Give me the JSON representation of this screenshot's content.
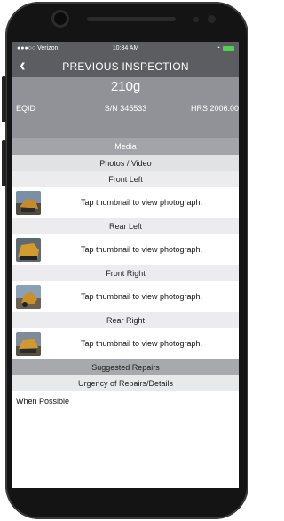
{
  "status": {
    "carrier": "●●●○○ Verizon",
    "time": "10:34 AM"
  },
  "nav": {
    "back_icon": "chevron-left-icon",
    "title": "PREVIOUS INSPECTION"
  },
  "equipment": {
    "model": "210g",
    "eqid_label": "EQID",
    "serial": "S/N 345533",
    "hours": "HRS 2006.00"
  },
  "media": {
    "header": "Media",
    "photos_header": "Photos / Video",
    "photos": [
      {
        "label": "Front Left",
        "tap_text": "Tap thumbnail to view photograph."
      },
      {
        "label": "Rear Left",
        "tap_text": "Tap thumbnail to view photograph."
      },
      {
        "label": "Front Right",
        "tap_text": "Tap thumbnail to view photograph."
      },
      {
        "label": "Rear Right",
        "tap_text": "Tap thumbnail to view photograph."
      }
    ]
  },
  "repairs": {
    "header": "Suggested Repairs",
    "urgency_header": "Urgency of Repairs/Details",
    "urgency_value": "When Possible"
  },
  "colors": {
    "header_bg": "#5c5d61",
    "equip_bg": "#919297",
    "subheader_bg": "#e1e2e4",
    "battery": "#4fd34f"
  }
}
